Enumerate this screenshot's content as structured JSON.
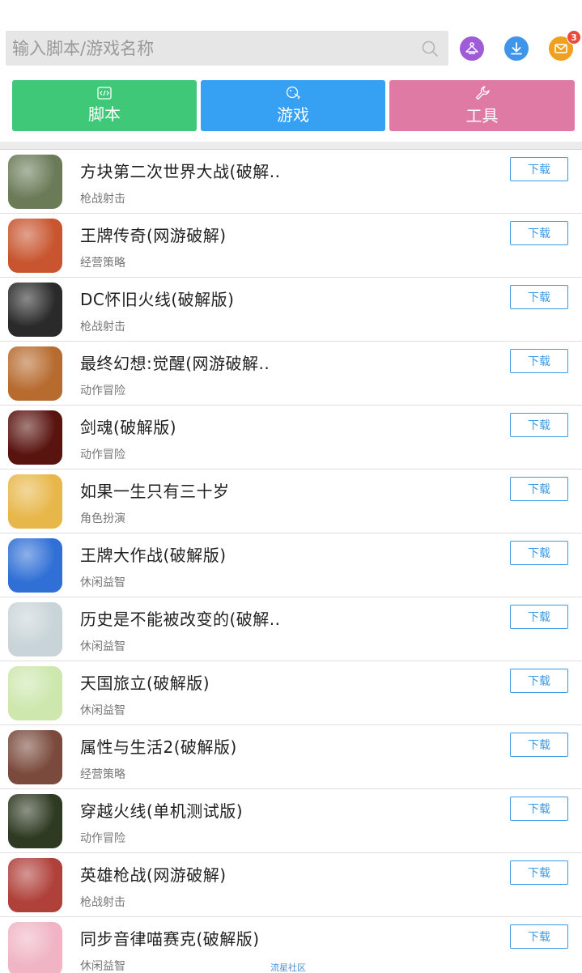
{
  "search": {
    "placeholder": "输入脚本/游戏名称"
  },
  "header_icons": [
    {
      "name": "hanger-icon",
      "color": "#a05bd6"
    },
    {
      "name": "download-icon",
      "color": "#3f95ea"
    },
    {
      "name": "mail-icon",
      "color": "#f0a01e"
    }
  ],
  "mail_badge": "3",
  "categories": [
    {
      "label": "脚本",
      "icon": "code-icon",
      "color": "#3ec877"
    },
    {
      "label": "游戏",
      "icon": "game-pad-icon",
      "color": "#36a0f2"
    },
    {
      "label": "工具",
      "icon": "wrench-icon",
      "color": "#de7aa3"
    }
  ],
  "download_label": "下载",
  "games": [
    {
      "title": "方块第二次世界大战(破解..",
      "category": "枪战射击",
      "icon_color": "#6b7b58"
    },
    {
      "title": "王牌传奇(网游破解)",
      "category": "经营策略",
      "icon_color": "#c8552f"
    },
    {
      "title": "DC怀旧火线(破解版)",
      "category": "枪战射击",
      "icon_color": "#2a2a2a"
    },
    {
      "title": "最终幻想:觉醒(网游破解..",
      "category": "动作冒险",
      "icon_color": "#b76b2f"
    },
    {
      "title": "剑魂(破解版)",
      "category": "动作冒险",
      "icon_color": "#5a1410"
    },
    {
      "title": "如果一生只有三十岁",
      "category": "角色扮演",
      "icon_color": "#e8b74a"
    },
    {
      "title": "王牌大作战(破解版)",
      "category": "休闲益智",
      "icon_color": "#2f6fd6"
    },
    {
      "title": "历史是不能被改变的(破解..",
      "category": "休闲益智",
      "icon_color": "#c9d4d8"
    },
    {
      "title": "天国旅立(破解版)",
      "category": "休闲益智",
      "icon_color": "#cde7ae"
    },
    {
      "title": "属性与生活2(破解版)",
      "category": "经营策略",
      "icon_color": "#7a4a3c"
    },
    {
      "title": "穿越火线(单机测试版)",
      "category": "动作冒险",
      "icon_color": "#2f3a22"
    },
    {
      "title": "英雄枪战(网游破解)",
      "category": "枪战射击",
      "icon_color": "#b0403a"
    },
    {
      "title": "同步音律喵赛克(破解版)",
      "category": "休闲益智",
      "icon_color": "#f0b4c4"
    }
  ],
  "watermark": "流星社区"
}
